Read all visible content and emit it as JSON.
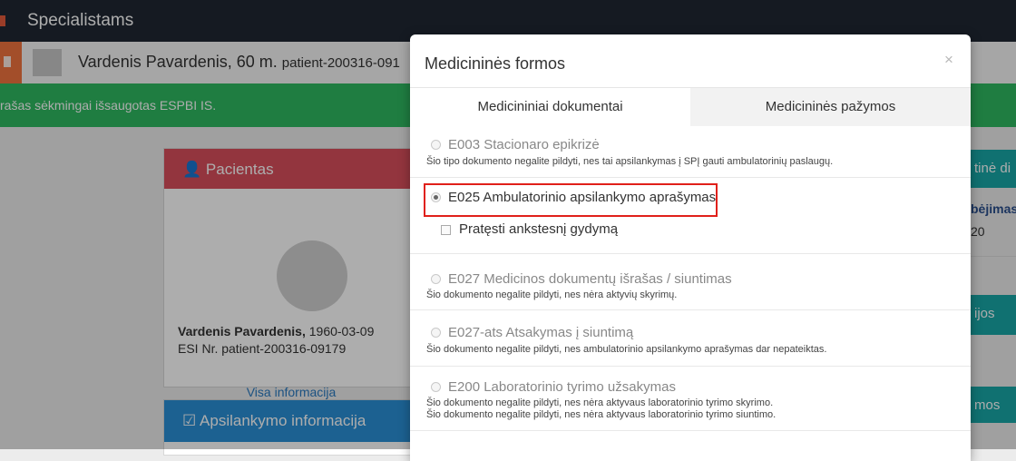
{
  "topbar": {
    "title": "Specialistams"
  },
  "patient_bar": {
    "name": "Vardenis Pavardenis, 60 m.",
    "patient_id": "patient-200316-091"
  },
  "alert": {
    "text": "rašas sėkmingai išsaugotas ESPBI IS."
  },
  "patient_card": {
    "header": "Pacientas",
    "name": "Vardenis Pavardenis,",
    "birth_date": "1960-03-09",
    "esi": "ESI Nr. patient-200316-09179",
    "more_link": "Visa informacija"
  },
  "visit_card": {
    "header": "Apsilankymo informacija"
  },
  "right_panel": {
    "card1": "tinė di",
    "text1": "bėjimas",
    "text2": "20",
    "card2": "ijos",
    "card3": "mos"
  },
  "modal": {
    "title": "Medicininės formos",
    "close": "×",
    "tabs": [
      "Medicininiai dokumentai",
      "Medicininės pažymos"
    ],
    "options": [
      {
        "label": "E003 Stacionaro epikrizė",
        "desc": "Šio tipo dokumento negalite pildyti, nes tai apsilankymas į SPĮ gauti ambulatorinių paslaugų.",
        "selected": false
      },
      {
        "label": "E025 Ambulatorinio apsilankymo aprašymas",
        "selected": true,
        "sub_checkbox": "Pratęsti ankstesnį gydymą"
      },
      {
        "label": "E027 Medicinos dokumentų išrašas / siuntimas",
        "desc": "Šio dokumento negalite pildyti, nes nėra aktyvių skyrimų.",
        "selected": false
      },
      {
        "label": "E027-ats Atsakymas į siuntimą",
        "desc": "Šio dokumento negalite pildyti, nes ambulatorinio apsilankymo aprašymas dar nepateiktas.",
        "selected": false
      },
      {
        "label": "E200 Laboratorinio tyrimo užsakymas",
        "desc": "Šio dokumento negalite pildyti, nes nėra aktyvaus laboratorinio tyrimo skyrimo.",
        "desc2": "Šio dokumento negalite pildyti, nes nėra aktyvaus laboratorinio tyrimo siuntimo.",
        "selected": false
      }
    ]
  },
  "colors": {
    "topbar": "#1f2733",
    "alert": "#2fb860",
    "patient_header": "#d94f5c",
    "visit_header": "#2a8fd6",
    "highlight": "#e0201a"
  }
}
